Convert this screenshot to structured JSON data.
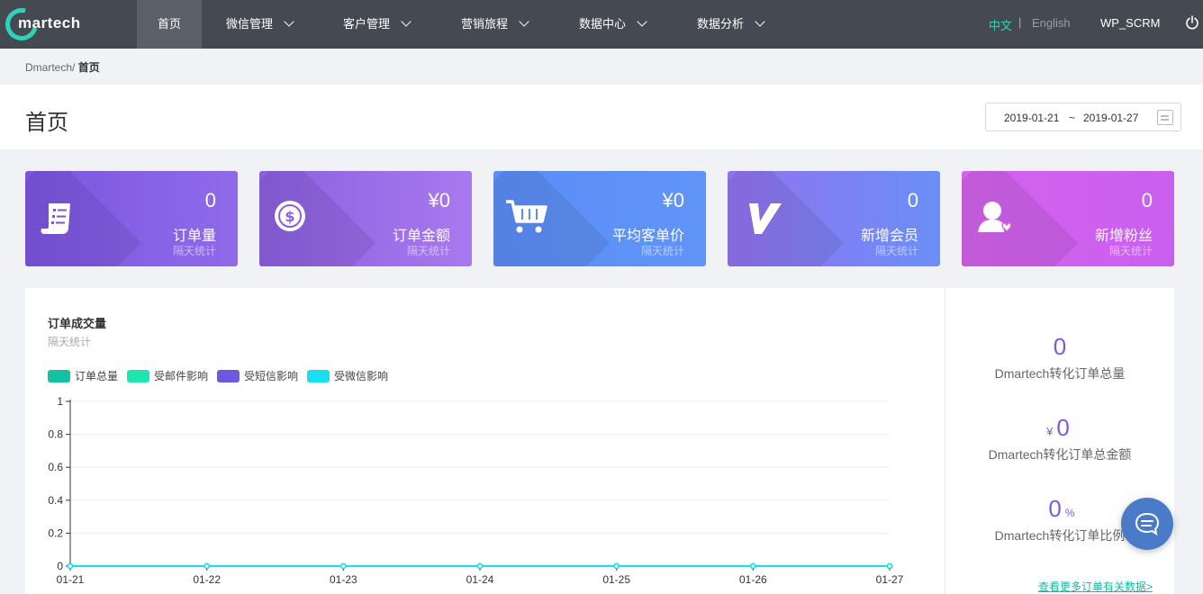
{
  "app": {
    "logo_text": "martech"
  },
  "nav": {
    "items": [
      {
        "label": "首页"
      },
      {
        "label": "微信管理"
      },
      {
        "label": "客户管理"
      },
      {
        "label": "营销旅程"
      },
      {
        "label": "数据中心"
      },
      {
        "label": "数据分析"
      }
    ],
    "lang_zh": "中文",
    "lang_sep": "|",
    "lang_en": "English",
    "user": "WP_SCRM",
    "accent_color": "#2ed3b7"
  },
  "breadcrumb": {
    "root": "Dmartech/",
    "current": "首页"
  },
  "page": {
    "title": "首页",
    "date_start": "2019-01-21",
    "date_sep": "~",
    "date_end": "2019-01-27"
  },
  "cards": [
    {
      "value": "0",
      "label": "订单量",
      "sub": "隔天统计",
      "icon": "receipt-icon",
      "color_from": "#7a55e0",
      "color_to": "#8f6bea"
    },
    {
      "value": "¥0",
      "label": "订单金额",
      "sub": "隔天统计",
      "icon": "dollar-coin-icon",
      "color_from": "#8c5fe0",
      "color_to": "#a879ee"
    },
    {
      "value": "¥0",
      "label": "平均客单价",
      "sub": "隔天统计",
      "icon": "shopping-cart-icon",
      "color_from": "#5b8ef7",
      "color_to": "#5f93f7"
    },
    {
      "value": "0",
      "label": "新增会员",
      "sub": "隔天统计",
      "icon": "vip-v-icon",
      "color_from": "#9372f0",
      "color_to": "#6a8ff6"
    },
    {
      "value": "0",
      "label": "新增粉丝",
      "sub": "隔天统计",
      "icon": "user-heart-icon",
      "color_from": "#d463ec",
      "color_to": "#c95ff0"
    }
  ],
  "chart": {
    "title": "订单成交量",
    "subtitle": "隔天统计",
    "legend": [
      {
        "name": "订单总量",
        "color": "#13c2a3"
      },
      {
        "name": "受邮件影响",
        "color": "#1fe6b0"
      },
      {
        "name": "受短信影响",
        "color": "#6e58e0"
      },
      {
        "name": "受微信影响",
        "color": "#17e0f0"
      }
    ]
  },
  "chart_data": {
    "type": "line",
    "x": [
      "01-21",
      "01-22",
      "01-23",
      "01-24",
      "01-25",
      "01-26",
      "01-27"
    ],
    "yticks": [
      "0",
      "0.2",
      "0.4",
      "0.6",
      "0.8",
      "1"
    ],
    "ylim": [
      0,
      1
    ],
    "grid": true,
    "legend_position": "top-left",
    "series": [
      {
        "name": "订单总量",
        "values": [
          0,
          0,
          0,
          0,
          0,
          0,
          0
        ]
      },
      {
        "name": "受邮件影响",
        "values": [
          0,
          0,
          0,
          0,
          0,
          0,
          0
        ]
      },
      {
        "name": "受短信影响",
        "values": [
          0,
          0,
          0,
          0,
          0,
          0,
          0
        ]
      },
      {
        "name": "受微信影响",
        "values": [
          0,
          0,
          0,
          0,
          0,
          0,
          0
        ]
      }
    ]
  },
  "kpis": [
    {
      "prefix": "",
      "value": "0",
      "suffix": "",
      "label": "Dmartech转化订单总量"
    },
    {
      "prefix": "¥",
      "value": "0",
      "suffix": "",
      "label": "Dmartech转化订单总金额"
    },
    {
      "prefix": "",
      "value": "0",
      "suffix": "%",
      "label": "Dmartech转化订单比例"
    }
  ],
  "more_link": "查看更多订单有关数据>",
  "chat_icon": "chat-bubble-icon"
}
